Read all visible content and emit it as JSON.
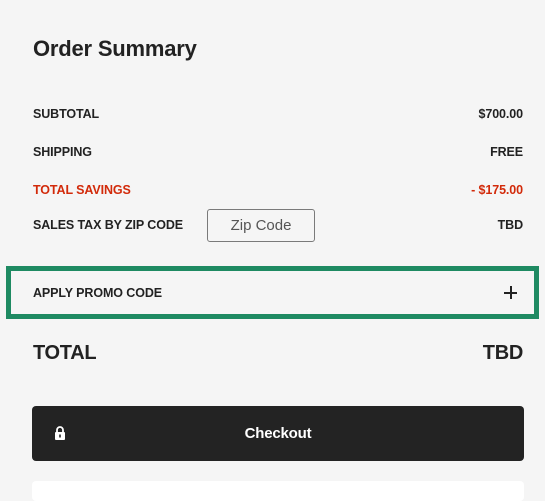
{
  "summary": {
    "title": "Order Summary",
    "subtotal": {
      "label": "SUBTOTAL",
      "value": "$700.00"
    },
    "shipping": {
      "label": "SHIPPING",
      "value": "FREE"
    },
    "savings": {
      "label": "TOTAL SAVINGS",
      "value": "- $175.00"
    },
    "tax": {
      "label": "SALES TAX BY ZIP CODE",
      "zip_placeholder": "Zip Code",
      "value": "TBD"
    },
    "promo": {
      "label": "APPLY PROMO CODE",
      "icon": "plus-icon"
    },
    "total": {
      "label": "TOTAL",
      "value": "TBD"
    },
    "checkout": {
      "label": "Checkout",
      "icon": "lock-icon"
    }
  },
  "colors": {
    "background": "#f5f5f5",
    "text": "#222222",
    "savings": "#d22a0a",
    "focus_outline": "#1e8a62",
    "button": "#232323"
  }
}
